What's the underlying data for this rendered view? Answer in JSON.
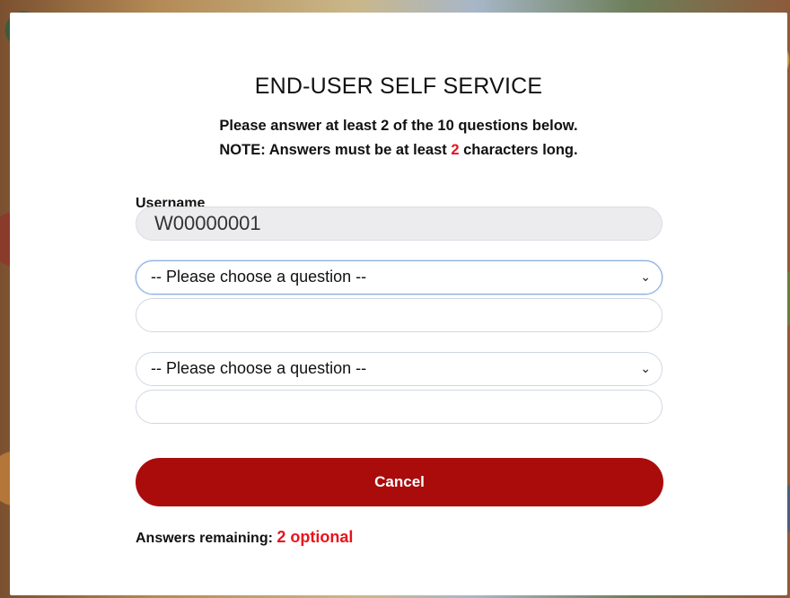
{
  "dialog": {
    "title": "END-USER SELF SERVICE",
    "instruction_line1": "Please answer at least 2 of the 10 questions below.",
    "note_prefix": "NOTE: Answers must be at least ",
    "note_number": "2",
    "note_suffix": " characters long."
  },
  "form": {
    "username_label": "Username",
    "username_value": "W00000001",
    "questions": [
      {
        "selected": "-- Please choose a question --",
        "answer": ""
      },
      {
        "selected": "-- Please choose a question --",
        "answer": ""
      }
    ],
    "cancel_label": "Cancel"
  },
  "footer": {
    "remaining_label": "Answers remaining: ",
    "remaining_value": "2 optional"
  },
  "colors": {
    "accent_red": "#aa0c0c",
    "highlight_red": "#e8141c"
  }
}
